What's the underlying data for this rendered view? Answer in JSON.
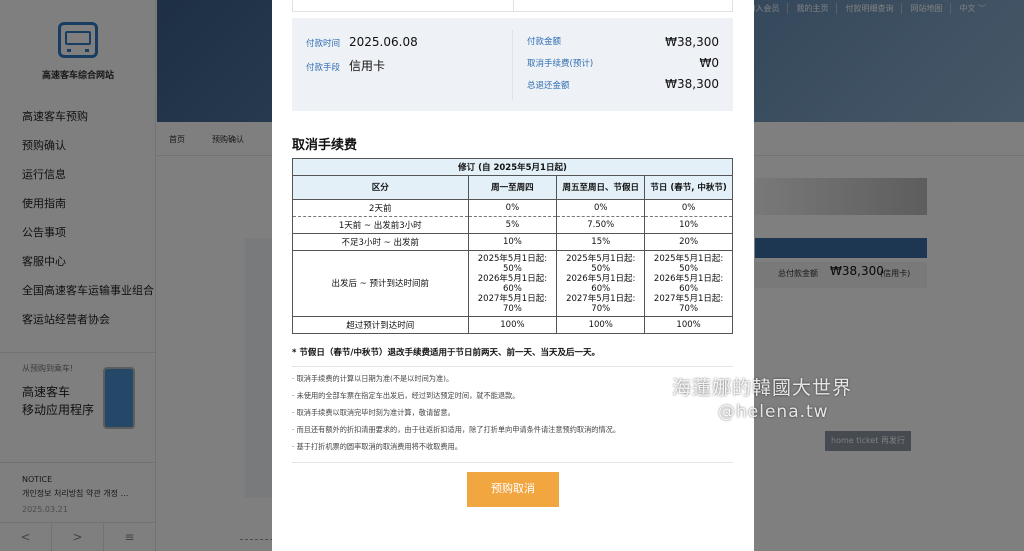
{
  "sidebar": {
    "logo_text": "高速客车综合网站",
    "menu": [
      "高速客车预购",
      "预购确认",
      "运行信息",
      "使用指南",
      "公告事项",
      "客服中心",
      "全国高速客车运输事业组合",
      "客运站经营者协会"
    ],
    "app_small": "从预购到乘车!",
    "app_title_1": "高速客车",
    "app_title_2": "移动应用程序",
    "notice_heading": "NOTICE",
    "notice_title": "개인정보 처리방침 약관 개정 …",
    "notice_date": "2025.03.21",
    "pager": [
      "<",
      ">",
      "≡"
    ]
  },
  "header": {
    "top_links": [
      "加入会员",
      "我的主页",
      "付款明细查询",
      "网站地图",
      "中文 ﹀"
    ],
    "crumb_home": "首页",
    "crumb_current": "预购确认"
  },
  "background": {
    "sum_label": "总付款金额",
    "sum_value": "₩38,300",
    "sum_card": "(信用卡)",
    "reissue_button": "home ticket 再发行"
  },
  "modal": {
    "payment": {
      "time_label": "付款时间",
      "time_value": "2025.06.08",
      "method_label": "付款手段",
      "method_value": "信用卡",
      "amount_label": "付款金额",
      "amount_value": "₩38,300",
      "fee_label": "取消手续费(预计)",
      "fee_value": "₩0",
      "refund_label": "总退还金额",
      "refund_value": "₩38,300"
    },
    "section_title": "取消手续费",
    "table": {
      "caption": "修订 (自 2025年5月1日起)",
      "headers": [
        "区分",
        "周一至周四",
        "周五至周日、节假日",
        "节日 (春节, 中秋节)"
      ],
      "rows": [
        [
          "2天前",
          "0%",
          "0%",
          "0%"
        ],
        [
          "1天前 ~ 出发前3小时",
          "5%",
          "7.50%",
          "10%"
        ],
        [
          "不足3小时 ~ 出发前",
          "10%",
          "15%",
          "20%"
        ]
      ],
      "multi_row": {
        "label": "出发后 ~ 预计到达时间前",
        "cell_lines": [
          "2025年5月1日起:",
          "50%",
          "2026年5月1日起:",
          "60%",
          "2027年5月1日起:",
          "70%"
        ]
      },
      "last_row": [
        "超过预计到达时间",
        "100%",
        "100%",
        "100%"
      ]
    },
    "holiday_note": "* 节假日（春节/中秋节）退改手续费适用于节日前两天、前一天、当天及后一天。",
    "notes": [
      "取消手续费的计算以日期为准(不是以时间为准)。",
      "未使用的全部车票在指定车出发后，经过到达预定时间，就不能退款。",
      "取消手续费以取消完毕时刻为准计算，敬请留意。",
      "而且还有额外的折扣清册要求的，由于往返折扣适用，除了打折单向申请条件请注意预约取消的情况。",
      "基于打折机票的圆率取消的取消费用将不收取费用。"
    ],
    "cancel_button": "预购取消"
  },
  "watermark": {
    "line1": "海蓮娜的韓國大世界",
    "line2": "@helena.tw"
  },
  "colors": {
    "accent_blue": "#2f6fb3",
    "button_orange": "#f1a640",
    "table_header": "#e3f0f7"
  }
}
